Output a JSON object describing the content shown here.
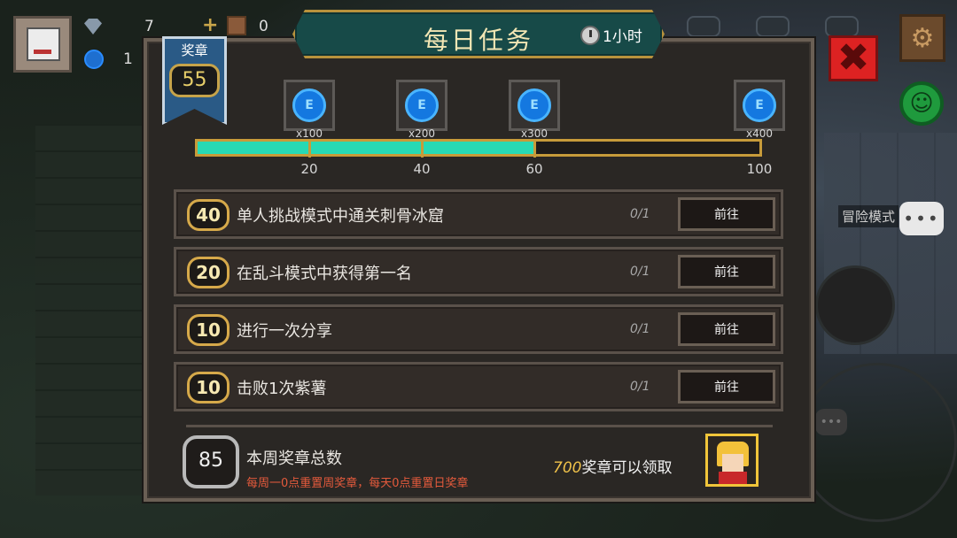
{
  "hud": {
    "gems": "7",
    "coins": "1",
    "chest_count": "0",
    "plus": "+"
  },
  "side": {
    "mode_label": "冒险模式",
    "chat_dots": "•••"
  },
  "panel": {
    "title": "每日任务",
    "timer": "1小时",
    "badge_label": "奖章",
    "badge_count": "55"
  },
  "rewards": [
    {
      "qty": "x100"
    },
    {
      "qty": "x200"
    },
    {
      "qty": "x300"
    },
    {
      "qty": "x400"
    }
  ],
  "progress": {
    "value": 60,
    "max": 100,
    "ticks": [
      "20",
      "40",
      "60",
      "100"
    ]
  },
  "tasks": [
    {
      "points": "40",
      "name": "单人挑战模式中通关刺骨冰窟",
      "progress": "0/1",
      "button": "前往"
    },
    {
      "points": "20",
      "name": "在乱斗模式中获得第一名",
      "progress": "0/1",
      "button": "前往"
    },
    {
      "points": "10",
      "name": "进行一次分享",
      "progress": "0/1",
      "button": "前往"
    },
    {
      "points": "10",
      "name": "击败1次紫薯",
      "progress": "0/1",
      "button": "前往"
    }
  ],
  "footer": {
    "week_total": "85",
    "week_title": "本周奖章总数",
    "reset_note": "每周一0点重置周奖章，每天0点重置日奖章",
    "claim_number": "700",
    "claim_text": "奖章可以领取"
  },
  "colors": {
    "progress_fill": "#27d9b4",
    "frame_gold": "#c79b3a",
    "close_red": "#dd2222"
  }
}
